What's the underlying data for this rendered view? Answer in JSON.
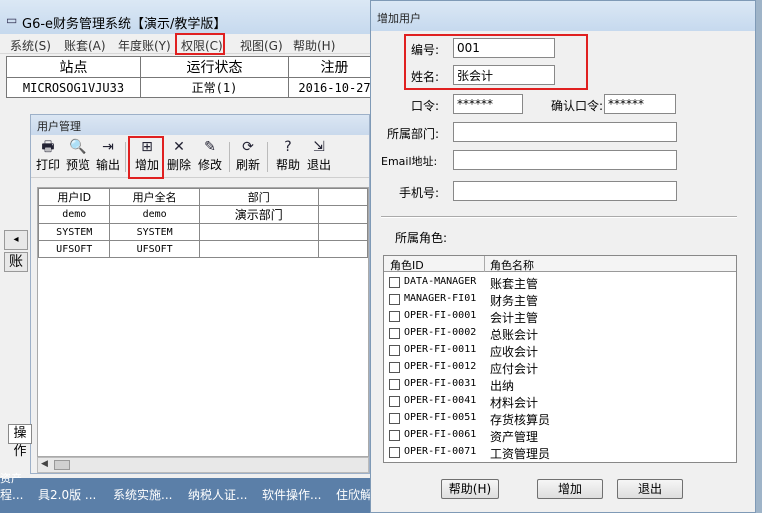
{
  "main_window": {
    "title": "G6-e财务管理系统【演示/教学版】",
    "menu": [
      "系统(S)",
      "账套(A)",
      "年度账(Y)",
      "权限(C)",
      "视图(G)",
      "帮助(H)"
    ]
  },
  "station_table": {
    "headers": [
      "站点",
      "运行状态",
      "注册"
    ],
    "row": [
      "MICROSOG1VJU33",
      "正常(1)",
      "2016-10-27"
    ]
  },
  "left_strip": {
    "arrow": "◂",
    "tab_text": "账",
    "ops_tab": "操作"
  },
  "user_mgmt": {
    "title": "用户管理",
    "toolbar": [
      {
        "icon": "printer-icon",
        "glyph": "🖶",
        "label": "打印"
      },
      {
        "icon": "preview-icon",
        "glyph": "🔍",
        "label": "预览"
      },
      {
        "icon": "export-icon",
        "glyph": "⇥",
        "label": "输出"
      },
      {
        "icon": "add-icon",
        "glyph": "⊞",
        "label": "增加"
      },
      {
        "icon": "delete-icon",
        "glyph": "✕",
        "label": "删除"
      },
      {
        "icon": "edit-icon",
        "glyph": "✎",
        "label": "修改"
      },
      {
        "icon": "refresh-icon",
        "glyph": "⟳",
        "label": "刷新"
      },
      {
        "icon": "help-icon",
        "glyph": "?",
        "label": "帮助"
      },
      {
        "icon": "exit-icon",
        "glyph": "⇲",
        "label": "退出"
      }
    ],
    "columns": [
      "用户ID",
      "用户全名",
      "部门"
    ],
    "rows": [
      {
        "id": "demo",
        "name": "demo",
        "dept": "演示部门"
      },
      {
        "id": "SYSTEM",
        "name": "SYSTEM",
        "dept": ""
      },
      {
        "id": "UFSOFT",
        "name": "UFSOFT",
        "dept": ""
      }
    ]
  },
  "taskbar": {
    "items": [
      "具2.0版 ...",
      "系统实施...",
      "纳税人证...",
      "软件操作...",
      "住欣解"
    ],
    "left_top": "资产",
    "left_bottom": "程..."
  },
  "dialog": {
    "title": "增加用户",
    "fields": {
      "code_label": "编号:",
      "code_value": "001",
      "name_label": "姓名:",
      "name_value": "张会计",
      "password_label": "口令:",
      "password_value": "******",
      "confirm_label": "确认口令:",
      "confirm_value": "******",
      "dept_label": "所属部门:",
      "dept_value": "",
      "email_label": "Email地址:",
      "email_value": "",
      "phone_label": "手机号:",
      "phone_value": ""
    },
    "roles_label": "所属角色:",
    "role_columns": [
      "角色ID",
      "角色名称"
    ],
    "roles": [
      {
        "id": "DATA-MANAGER",
        "name": "账套主管"
      },
      {
        "id": "MANAGER-FI01",
        "name": "财务主管"
      },
      {
        "id": "OPER-FI-0001",
        "name": "会计主管"
      },
      {
        "id": "OPER-FI-0002",
        "name": "总账会计"
      },
      {
        "id": "OPER-FI-0011",
        "name": "应收会计"
      },
      {
        "id": "OPER-FI-0012",
        "name": "应付会计"
      },
      {
        "id": "OPER-FI-0031",
        "name": "出纳"
      },
      {
        "id": "OPER-FI-0041",
        "name": "材料会计"
      },
      {
        "id": "OPER-FI-0051",
        "name": "存货核算员"
      },
      {
        "id": "OPER-FI-0061",
        "name": "资产管理"
      },
      {
        "id": "OPER-FI-0071",
        "name": "工资管理员"
      }
    ],
    "buttons": {
      "help": "帮助(H)",
      "add": "增加",
      "exit": "退出"
    }
  },
  "highlight_color": "#e02020"
}
